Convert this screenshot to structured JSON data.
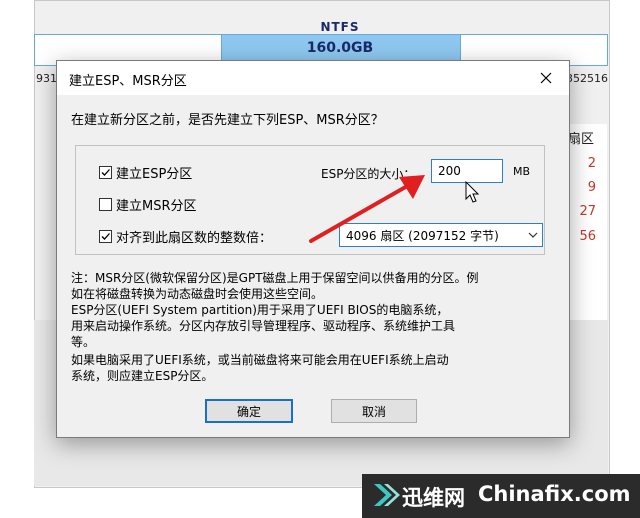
{
  "background": {
    "disk_fs": "NTFS",
    "disk_size": "160.0GB",
    "left_number": "931",
    "right_number": "352516",
    "sector_header": "扇区",
    "sector_values": [
      "2",
      "9",
      "27",
      "56"
    ]
  },
  "dialog": {
    "title": "建立ESP、MSR分区",
    "close_glyph": "×",
    "question": "在建立新分区之前，是否先建立下列ESP、MSR分区？",
    "options": {
      "create_esp": {
        "label": "建立ESP分区",
        "checked": true
      },
      "create_msr": {
        "label": "建立MSR分区",
        "checked": false
      },
      "align": {
        "label": "对齐到此扇区数的整数倍：",
        "checked": true
      }
    },
    "esp_size": {
      "label": "ESP分区的大小：",
      "value": "200",
      "unit": "MB"
    },
    "alignment_select": {
      "selected": "4096 扇区 (2097152 字节)"
    },
    "notes": [
      "注：MSR分区(微软保留分区)是GPT磁盘上用于保留空间以供备用的分区。例",
      "如在将磁盘转换为动态磁盘时会使用这些空间。",
      "    ESP分区(UEFI System partition)用于采用了UEFI BIOS的电脑系统，",
      "用来启动操作系统。分区内存放引导管理程序、驱动程序、系统维护工具",
      "等。",
      "    如果电脑采用了UEFI系统，或当前磁盘将来可能会用在UEFI系统上启动",
      "系统，则应建立ESP分区。"
    ],
    "buttons": {
      "ok": "确定",
      "cancel": "取消"
    }
  },
  "watermark": {
    "brand_cn": "迅维网",
    "brand_en": "Chinafix.com"
  },
  "colors": {
    "accent_blue": "#2a7fd4",
    "annotation_arrow": "#e02020",
    "sector_value_red": "#c0392b"
  },
  "icons": [
    "close-icon",
    "checkbox-checked-icon",
    "checkbox-unchecked-icon",
    "chevron-down-icon",
    "mouse-cursor-icon",
    "red-arrow-annotation",
    "chinafix-logo-icon"
  ]
}
